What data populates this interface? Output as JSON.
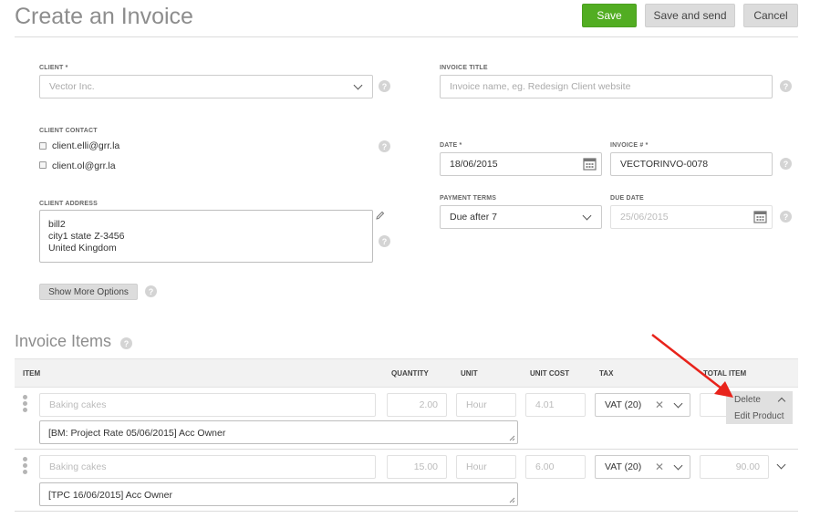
{
  "page": {
    "title": "Create an Invoice"
  },
  "toolbar": {
    "save_label": "Save",
    "save_send_label": "Save and send",
    "cancel_label": "Cancel"
  },
  "form": {
    "client_label": "CLIENT *",
    "client_value": "Vector Inc.",
    "invoice_title_label": "INVOICE TITLE",
    "invoice_title_placeholder": "Invoice name, eg. Redesign Client website",
    "client_contact_label": "CLIENT CONTACT",
    "contacts": [
      "client.elli@grr.la",
      "client.ol@grr.la"
    ],
    "date_label": "DATE *",
    "date_value": "18/06/2015",
    "invoice_no_label": "INVOICE # *",
    "invoice_no_value": "VECTORINVO-0078",
    "client_address_label": "CLIENT ADDRESS",
    "address_lines": [
      "bill2",
      "city1 state Z-3456",
      "United Kingdom"
    ],
    "payment_terms_label": "PAYMENT TERMS",
    "payment_terms_value": "Due after 7",
    "due_date_label": "DUE DATE",
    "due_date_value": "25/06/2015",
    "more_options_label": "Show More Options"
  },
  "items_section": {
    "title": "Invoice Items",
    "columns": {
      "item": "ITEM",
      "quantity": "QUANTITY",
      "unit": "UNIT",
      "unit_cost": "UNIT COST",
      "tax": "TAX",
      "total": "TOTAL ITEM"
    },
    "rows": [
      {
        "item_placeholder": "Baking cakes",
        "quantity": "2.00",
        "unit_placeholder": "Hour",
        "unit_cost": "4.01",
        "tax": "VAT (20)",
        "total": "",
        "description": "[BM: Project Rate 05/06/2015]  Acc Owner"
      },
      {
        "item_placeholder": "Baking cakes",
        "quantity": "15.00",
        "unit_placeholder": "Hour",
        "unit_cost": "6.00",
        "tax": "VAT (20)",
        "total": "90.00",
        "description": "[TPC 16/06/2015]  Acc Owner"
      }
    ],
    "row_menu": {
      "delete_label": "Delete",
      "edit_label": "Edit Product"
    }
  },
  "icons": {
    "help": "?",
    "help_icon": "question-circle-icon",
    "calendar_icon": "calendar-icon",
    "pencil_icon": "pencil-icon",
    "clear_icon": "close-icon"
  },
  "colors": {
    "primary": "#52ad22",
    "arrow": "#e8231b",
    "muted": "#8d8d8d"
  }
}
